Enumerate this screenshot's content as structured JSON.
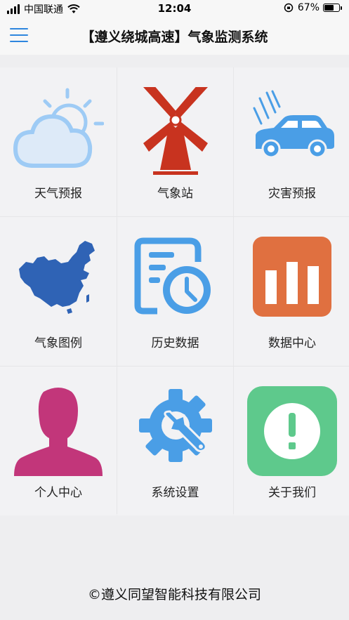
{
  "status_bar": {
    "carrier": "中国联通",
    "time": "12:04",
    "battery_percent": "67%",
    "battery_level": 0.67
  },
  "nav": {
    "title": "【遵义绕城高速】气象监测系统",
    "menu_icon": "hamburger-menu-icon"
  },
  "tiles": [
    {
      "label": "天气预报",
      "icon": "weather-cloud-sun-icon"
    },
    {
      "label": "气象站",
      "icon": "windmill-icon"
    },
    {
      "label": "灾害预报",
      "icon": "car-rain-icon"
    },
    {
      "label": "气象图例",
      "icon": "china-map-icon"
    },
    {
      "label": "历史数据",
      "icon": "document-clock-icon"
    },
    {
      "label": "数据中心",
      "icon": "bar-chart-icon"
    },
    {
      "label": "个人中心",
      "icon": "user-silhouette-icon"
    },
    {
      "label": "系统设置",
      "icon": "gear-wrench-icon"
    },
    {
      "label": "关于我们",
      "icon": "exclamation-icon"
    }
  ],
  "footer": "©遵义同望智能科技有限公司",
  "colors": {
    "accent": "#2e86de",
    "cloud": "#9ecbf5",
    "windmill": "#c8331f",
    "chart": "#e07040",
    "user": "#c2367a",
    "about": "#5ec98c",
    "map": "#2f63b5",
    "doc": "#4a9ee6"
  }
}
